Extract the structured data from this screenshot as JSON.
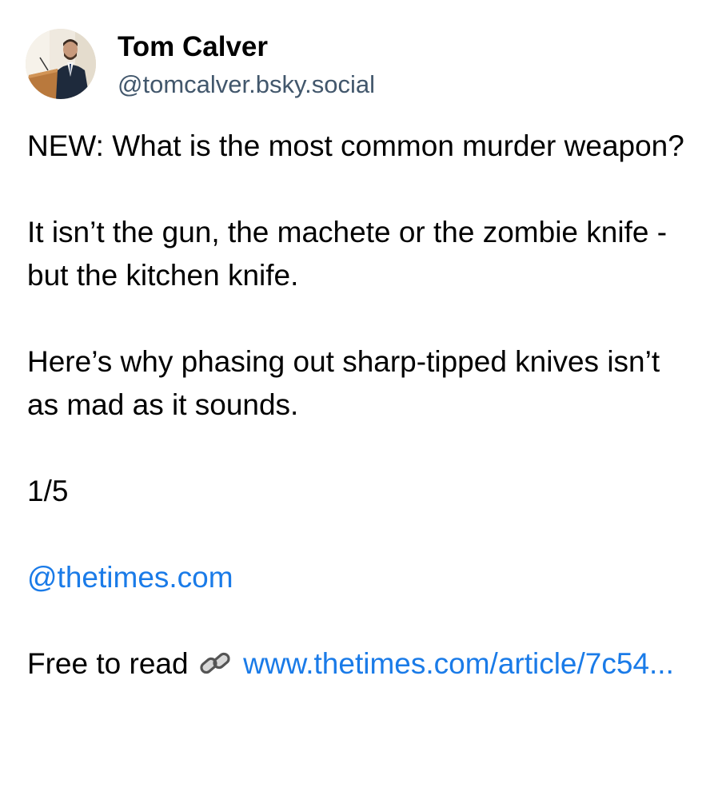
{
  "author": {
    "name": "Tom Calver",
    "handle": "@tomcalver.bsky.social"
  },
  "post": {
    "line1": "NEW: What is the most common murder weapon?",
    "line2": "It isn’t the gun, the machete or the zombie knife - but the kitchen knife.",
    "line3": "Here’s why phasing out sharp-tipped knives isn’t as mad as it sounds.",
    "thread_counter": "1/5",
    "mention": "@thetimes.com",
    "free_to_read_label": "Free to read",
    "link_icon": "chain-link-icon",
    "link_text": "www.thetimes.com/article/7c54..."
  },
  "colors": {
    "text": "#000000",
    "handle": "#42576c",
    "link": "#1a7be8"
  }
}
